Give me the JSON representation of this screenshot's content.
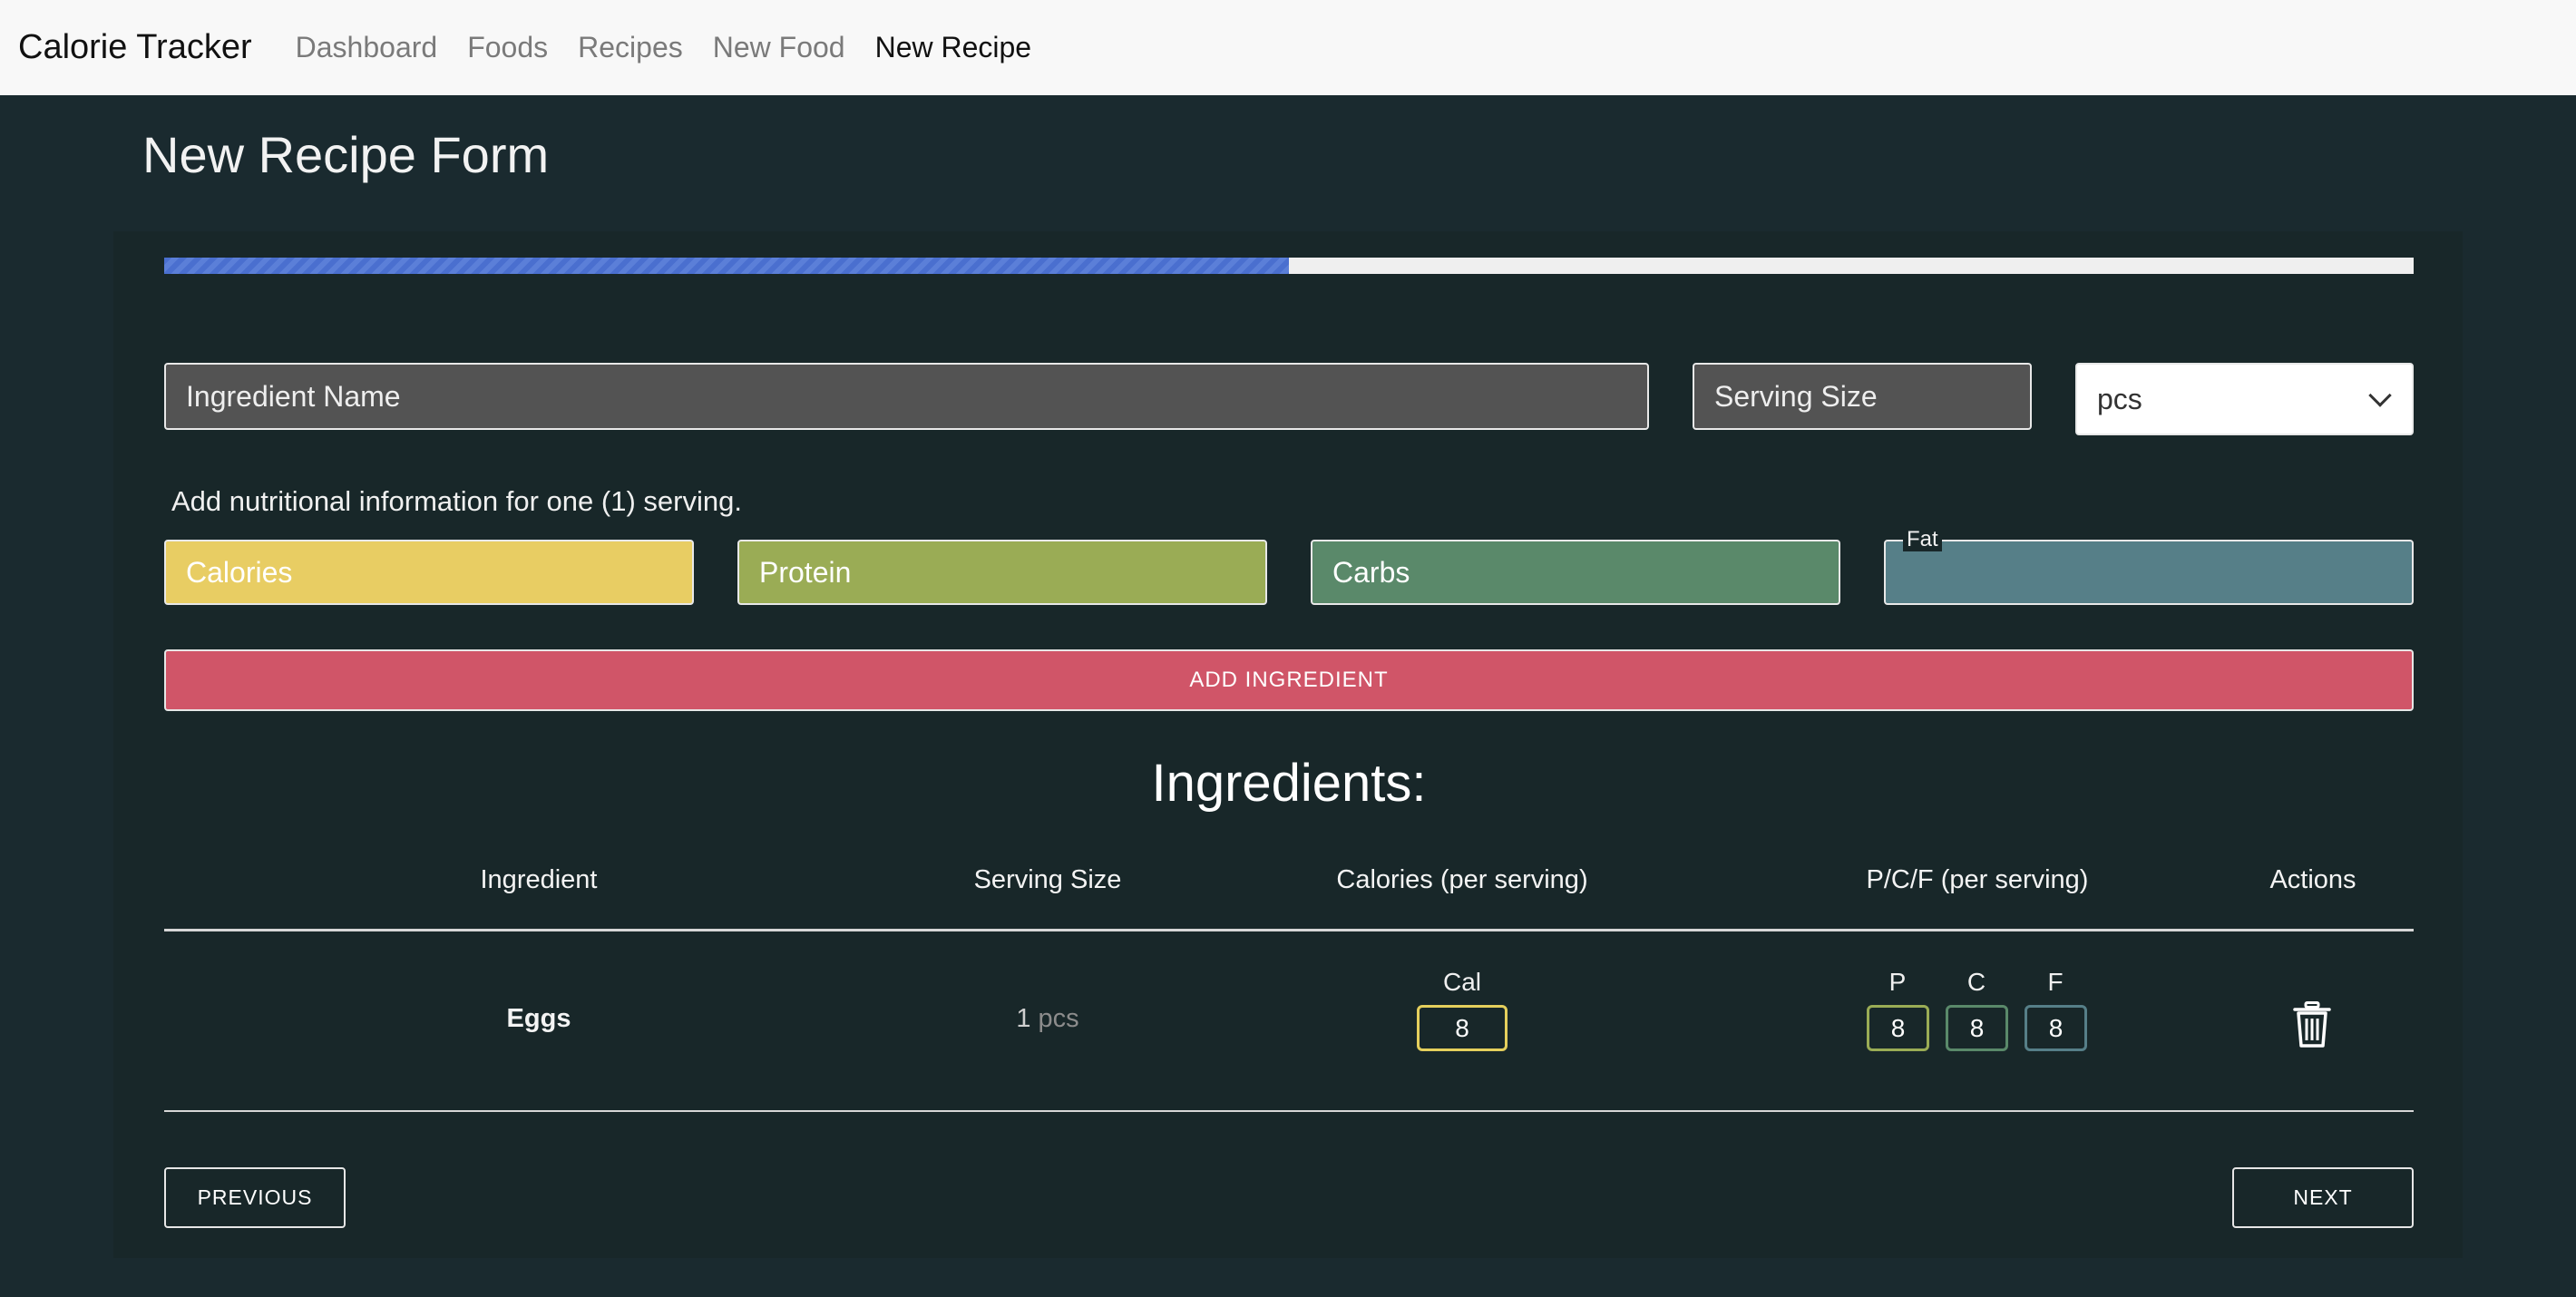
{
  "navbar": {
    "brand": "Calorie Tracker",
    "links": [
      "Dashboard",
      "Foods",
      "Recipes",
      "New Food",
      "New Recipe"
    ],
    "active": "New Recipe"
  },
  "page_title": "New Recipe Form",
  "progress": {
    "fraction": 0.5,
    "fill_color": "#4a6fcf"
  },
  "form": {
    "ingredient_name_placeholder": "Ingredient Name",
    "serving_size_placeholder": "Serving Size",
    "unit_value": "pcs",
    "hint": "Add nutritional information for one (1) serving.",
    "calories_placeholder": "Calories",
    "protein_placeholder": "Protein",
    "carbs_placeholder": "Carbs",
    "fat_label": "Fat",
    "add_button": "ADD INGREDIENT"
  },
  "ingredients": {
    "title": "Ingredients:",
    "headers": [
      "Ingredient",
      "Serving Size",
      "Calories (per serving)",
      "P/C/F (per serving)",
      "Actions"
    ],
    "rows": [
      {
        "name": "Eggs",
        "serving_qty": "1",
        "serving_unit": "pcs",
        "cal_label": "Cal",
        "calories": "8",
        "p_label": "P",
        "protein": "8",
        "c_label": "C",
        "carbs": "8",
        "f_label": "F",
        "fat": "8"
      }
    ]
  },
  "buttons": {
    "previous": "PREVIOUS",
    "next": "NEXT"
  },
  "colors": {
    "background": "#1a2a2f",
    "calories": "#e8cd63",
    "protein": "#9aac55",
    "carbs": "#5a896a",
    "fat": "#567f88",
    "add_button": "#d05568"
  },
  "icons": {
    "delete": "trash-icon",
    "select": "chevron-down-icon"
  }
}
